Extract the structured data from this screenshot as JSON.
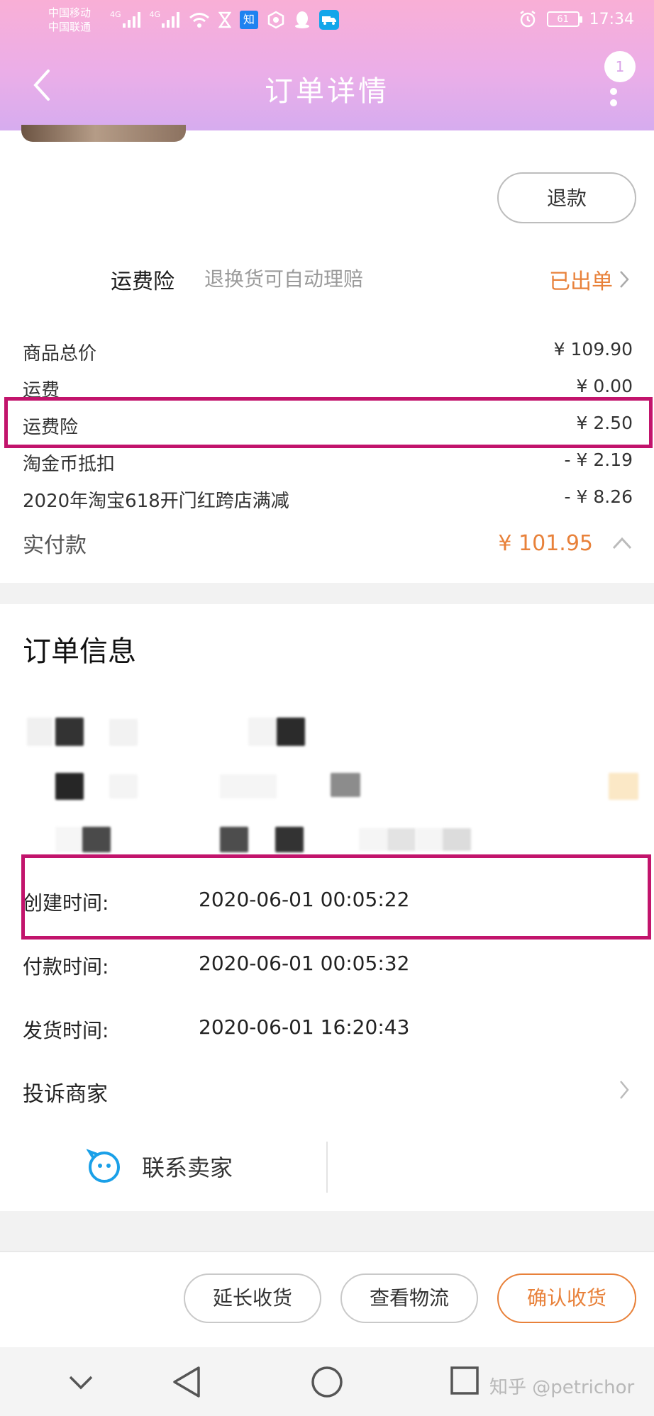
{
  "status_bar": {
    "carrier_1": "中国移动",
    "carrier_2": "中国联通",
    "network_1": "4G",
    "network_2": "4G",
    "app_badge": "知",
    "battery_level": "61",
    "time": "17:34"
  },
  "header": {
    "title": "订单详情",
    "notification_count": "1",
    "colors": {
      "gradient_top": "#f9afd6",
      "gradient_bottom": "#d6acef"
    }
  },
  "refund_button": "退款",
  "insurance": {
    "label": "运费险",
    "description": "退换货可自动理赔",
    "status": "已出单"
  },
  "price_breakdown": [
    {
      "label": "商品总价",
      "value": "¥ 109.90"
    },
    {
      "label": "运费",
      "value": "¥ 0.00"
    },
    {
      "label": "运费险",
      "value": "¥ 2.50"
    },
    {
      "label": "淘金币抵扣",
      "value": "- ¥ 2.19"
    },
    {
      "label": "2020年淘宝618开门红跨店满减",
      "value": "- ¥ 8.26"
    }
  ],
  "actual_payment": {
    "label": "实付款",
    "value": "¥ 101.95"
  },
  "order_info": {
    "title": "订单信息",
    "rows": [
      {
        "label": "创建时间:",
        "value": "2020-06-01 00:05:22"
      },
      {
        "label": "付款时间:",
        "value": "2020-06-01 00:05:32"
      },
      {
        "label": "发货时间:",
        "value": "2020-06-01 16:20:43"
      }
    ],
    "complain": "投诉商家",
    "contact_seller": "联系卖家"
  },
  "actions": {
    "extend": "延长收货",
    "logistics": "查看物流",
    "confirm": "确认收货"
  },
  "accent_color": "#e8813a",
  "highlight_color": "#c2146c",
  "watermark": "知乎 @petrichor"
}
